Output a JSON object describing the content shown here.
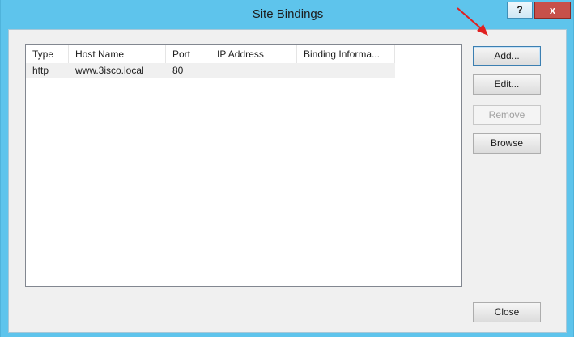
{
  "window": {
    "title": "Site Bindings",
    "help_label": "?",
    "close_label": "x"
  },
  "bindings": {
    "columns": [
      "Type",
      "Host Name",
      "Port",
      "IP Address",
      "Binding Informa..."
    ],
    "rows": [
      {
        "type": "http",
        "host_name": "www.3isco.local",
        "port": "80",
        "ip_address": "",
        "binding_info": ""
      }
    ]
  },
  "buttons": {
    "add": "Add...",
    "edit": "Edit...",
    "remove": "Remove",
    "browse": "Browse",
    "close": "Close"
  },
  "colors": {
    "title_bar": "#5ec4ec",
    "annotation_arrow": "#e02020"
  }
}
